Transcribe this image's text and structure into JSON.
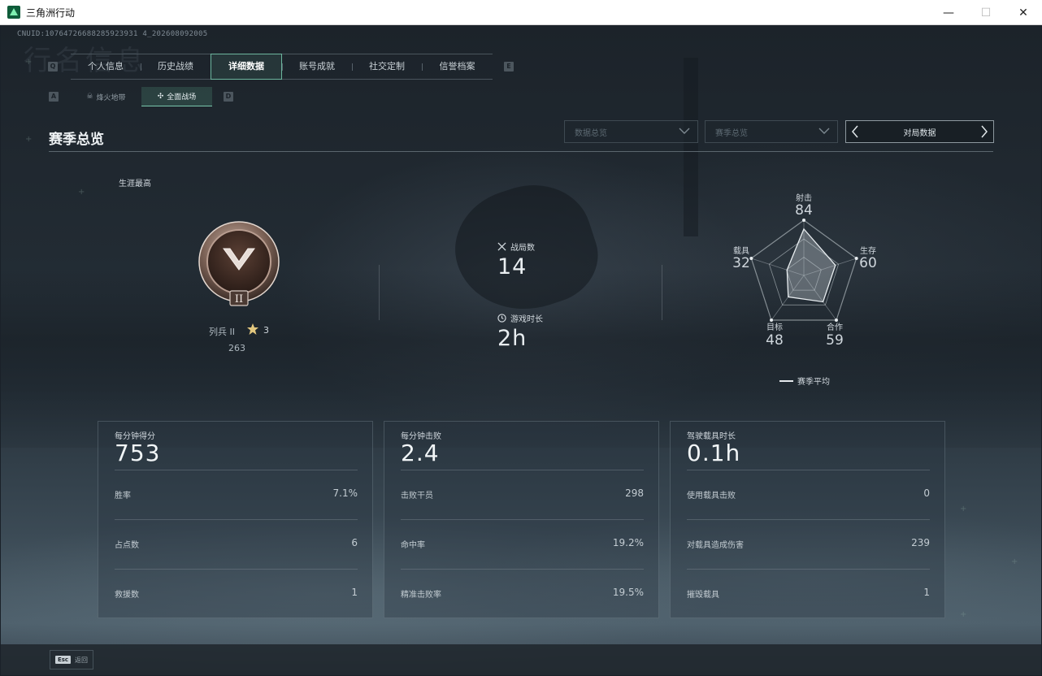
{
  "window": {
    "title": "三角洲行动",
    "minimize": "—",
    "maximize": "☐",
    "close": "✕"
  },
  "uid_text": "CNUID:10764726688285923931 4_202608092005",
  "watermark": "行名信息",
  "tabs": {
    "prev_key": "Q",
    "next_key": "E",
    "items": [
      {
        "label": "个人信息",
        "active": false
      },
      {
        "label": "历史战绩",
        "active": false
      },
      {
        "label": "详细数据",
        "active": true
      },
      {
        "label": "账号成就",
        "active": false
      },
      {
        "label": "社交定制",
        "active": false
      },
      {
        "label": "信誉档案",
        "active": false
      }
    ]
  },
  "subtabs": {
    "prev_key": "A",
    "next_key": "D",
    "items": [
      {
        "label": "烽火地带",
        "icon": "skull-icon",
        "active": false
      },
      {
        "label": "全面战场",
        "icon": "crosshair-icon",
        "active": true
      }
    ]
  },
  "section": {
    "title": "赛季总览",
    "dropdown1": "数据总览",
    "dropdown2": "赛季总览",
    "pager_label": "对局数据"
  },
  "rank": {
    "career_label": "生涯最高",
    "name": "列兵 II",
    "stars": "3",
    "points": "263",
    "badge_numeral": "II"
  },
  "overview": {
    "matches_label": "战局数",
    "matches_value": "14",
    "playtime_label": "游戏时长",
    "playtime_value": "2h"
  },
  "radar": {
    "axes": [
      {
        "label": "射击",
        "value": 84
      },
      {
        "label": "生存",
        "value": 60
      },
      {
        "label": "合作",
        "value": 59
      },
      {
        "label": "目标",
        "value": 48
      },
      {
        "label": "载具",
        "value": 32
      }
    ],
    "max": 100,
    "legend": "赛季平均"
  },
  "panels": [
    {
      "title": "每分钟得分",
      "big": "753",
      "rows": [
        {
          "label": "胜率",
          "value": "7.1%"
        },
        {
          "label": "占点数",
          "value": "6"
        },
        {
          "label": "救援数",
          "value": "1"
        }
      ]
    },
    {
      "title": "每分钟击败",
      "big": "2.4",
      "rows": [
        {
          "label": "击败干员",
          "value": "298"
        },
        {
          "label": "命中率",
          "value": "19.2%"
        },
        {
          "label": "精准击败率",
          "value": "19.5%"
        }
      ]
    },
    {
      "title": "驾驶载具时长",
      "big": "0.1h",
      "rows": [
        {
          "label": "使用载具击败",
          "value": "0"
        },
        {
          "label": "对载具造成伤害",
          "value": "239"
        },
        {
          "label": "摧毁载具",
          "value": "1"
        }
      ]
    }
  ],
  "footer": {
    "esc_key": "Esc",
    "back_label": "返回"
  },
  "colors": {
    "accent": "#6cb59e",
    "background": "#1f2830"
  }
}
